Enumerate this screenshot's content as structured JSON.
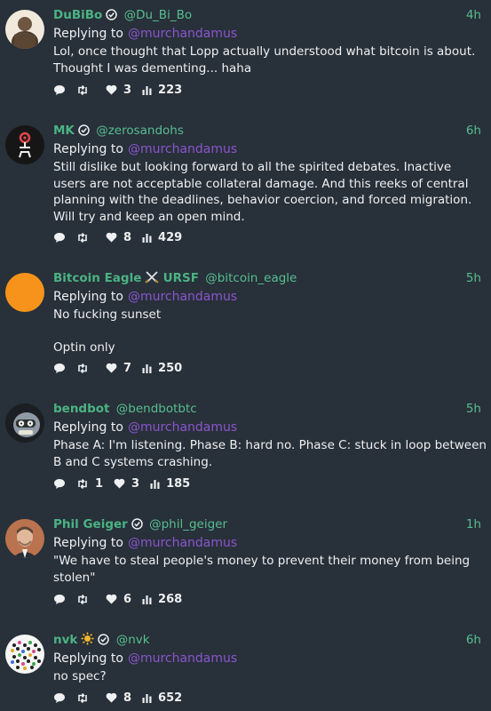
{
  "theme": {
    "background": "#283039",
    "name_color": "#4ab384",
    "handle_color": "#56bf91",
    "mention_color": "#8a55cf",
    "text_color": "#eef0f2"
  },
  "posts": [
    {
      "name": "DuBiBo",
      "handle": "@Du_Bi_Bo",
      "time": "4h",
      "reply_label": "Replying to",
      "reply_to": "@murchandamus",
      "text": "Lol, once thought that Lopp actually understood what bitcoin is about. Thought I was dementing... haha",
      "reposts": "",
      "likes": "3",
      "views": "223",
      "avatar_icon": "portrait-avatar-icon"
    },
    {
      "name": "MK",
      "handle": "@zerosandohs",
      "time": "6h",
      "reply_label": "Replying to",
      "reply_to": "@murchandamus",
      "text": "Still dislike but looking forward to all the spirited debates. Inactive users are not acceptable collateral damage. And this reeks of central planning with the deadlines, behavior coercion, and forced migration. Will try and keep an open mind.",
      "reposts": "",
      "likes": "8",
      "views": "429",
      "avatar_icon": "glyph-avatar-icon"
    },
    {
      "name": "Bitcoin Eagle",
      "name_suffix": "URSF",
      "handle": "@bitcoin_eagle",
      "time": "5h",
      "reply_label": "Replying to",
      "reply_to": "@murchandamus",
      "text": "No fucking sunset\n\nOptin only",
      "reposts": "",
      "likes": "7",
      "views": "250",
      "avatar_icon": "orange-circle-avatar-icon"
    },
    {
      "name": "bendbot",
      "handle": "@bendbotbtc",
      "time": "5h",
      "reply_label": "Replying to",
      "reply_to": "@murchandamus",
      "text": "Phase A: I'm listening.  Phase B: hard no.  Phase C: stuck in loop between B and C systems crashing.",
      "reposts": "1",
      "likes": "3",
      "views": "185",
      "avatar_icon": "robot-avatar-icon"
    },
    {
      "name": "Phil Geiger",
      "handle": "@phil_geiger",
      "time": "1h",
      "reply_label": "Replying to",
      "reply_to": "@murchandamus",
      "text": "\"We have to steal people's money to prevent their money from being stolen\"",
      "reposts": "",
      "likes": "6",
      "views": "268",
      "avatar_icon": "portrait-avatar-icon"
    },
    {
      "name": "nvk",
      "handle": "@nvk",
      "time": "6h",
      "reply_label": "Replying to",
      "reply_to": "@murchandamus",
      "text": "no spec?",
      "reposts": "",
      "likes": "8",
      "views": "652",
      "avatar_icon": "dotted-avatar-icon"
    }
  ]
}
